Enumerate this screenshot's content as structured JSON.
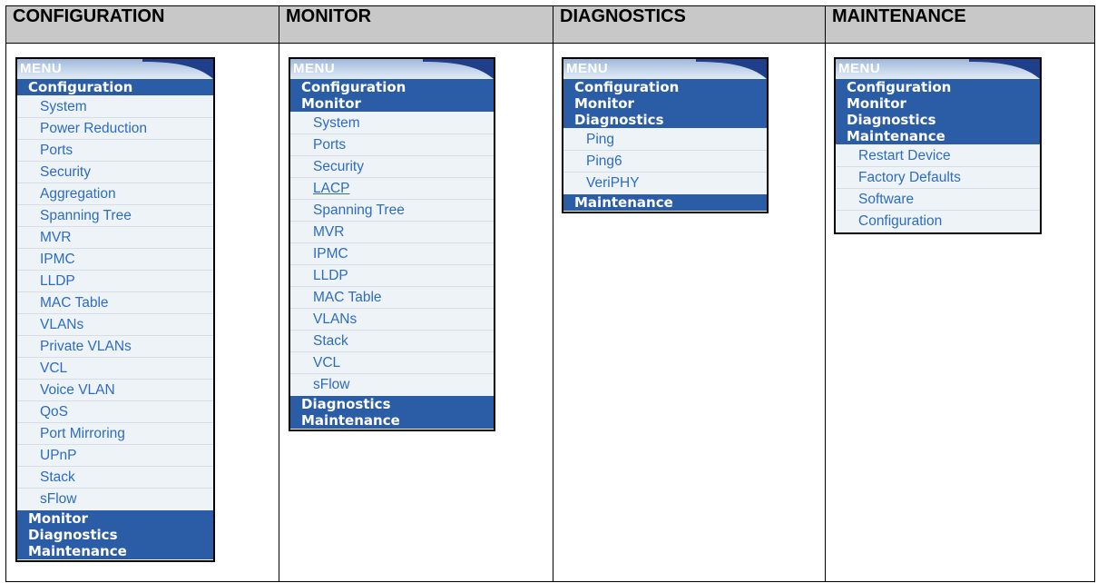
{
  "columns": [
    {
      "header": "CONFIGURATION",
      "menu_label": "MENU",
      "sections_before": [
        "Configuration"
      ],
      "items": [
        "System",
        "Power Reduction",
        "Ports",
        "Security",
        "Aggregation",
        "Spanning Tree",
        "MVR",
        "IPMC",
        "LLDP",
        "MAC Table",
        "VLANs",
        "Private VLANs",
        "VCL",
        "Voice VLAN",
        "QoS",
        "Port Mirroring",
        "UPnP",
        "Stack",
        "sFlow"
      ],
      "sections_after": [
        "Monitor",
        "Diagnostics",
        "Maintenance"
      ]
    },
    {
      "header": "MONITOR",
      "menu_label": "MENU",
      "sections_before": [
        "Configuration",
        "Monitor"
      ],
      "items": [
        "System",
        "Ports",
        "Security",
        "LACP",
        "Spanning Tree",
        "MVR",
        "IPMC",
        "LLDP",
        "MAC Table",
        "VLANs",
        "Stack",
        "VCL",
        "sFlow"
      ],
      "sections_after": [
        "Diagnostics",
        "Maintenance"
      ]
    },
    {
      "header": "DIAGNOSTICS",
      "menu_label": "MENU",
      "sections_before": [
        "Configuration",
        "Monitor",
        "Diagnostics"
      ],
      "items": [
        "Ping",
        "Ping6",
        "VeriPHY"
      ],
      "sections_after": [
        "Maintenance"
      ]
    },
    {
      "header": "MAINTENANCE",
      "menu_label": "MENU",
      "sections_before": [
        "Configuration",
        "Monitor",
        "Diagnostics",
        "Maintenance"
      ],
      "items": [
        "Restart Device",
        "Factory Defaults",
        "Software",
        "Configuration"
      ],
      "sections_after": []
    }
  ],
  "colors": {
    "header_bg": "#c8c8c8",
    "section_bg": "#2b5da6",
    "item_text": "#2d6cbf",
    "menu_bg": "#eef3f8",
    "flap": "#1f3f8a"
  }
}
